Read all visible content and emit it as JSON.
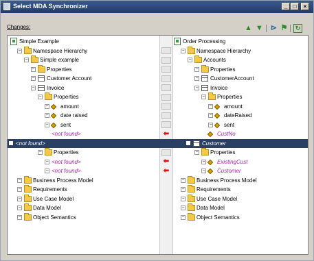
{
  "window": {
    "title": "Select MDA Synchronizer",
    "buttons": [
      "_",
      "□",
      "×"
    ]
  },
  "toolbar": {
    "changes_label": "Changes:",
    "icons": [
      "arrow-up-icon",
      "arrow-down-icon",
      "filter-icon",
      "flag-icon",
      "refresh-icon"
    ]
  },
  "colors": {
    "selected_row": "#2a3f64",
    "not_found_text": "#b020b0",
    "change_arrow": "#e01010"
  },
  "left_tree": [
    {
      "label": "Simple Example",
      "icon": "model-icon"
    },
    {
      "label": "Namespace Hierarchy",
      "icon": "folder-icon"
    },
    {
      "label": "Simple example",
      "icon": "folder-icon"
    },
    {
      "label": "Properties",
      "icon": "folder-icon"
    },
    {
      "label": "Customer Account",
      "icon": "class-icon"
    },
    {
      "label": "Invoice",
      "icon": "class-icon"
    },
    {
      "label": "Properties",
      "icon": "folder-icon"
    },
    {
      "label": "amount",
      "icon": "attribute-icon"
    },
    {
      "label": "date raised",
      "icon": "attribute-icon"
    },
    {
      "label": "sent",
      "icon": "attribute-icon"
    },
    {
      "label": "<not found>",
      "icon": "none"
    },
    {
      "label": "<not found>",
      "icon": "none"
    },
    {
      "label": "Properties",
      "icon": "folder-icon"
    },
    {
      "label": "<not found>",
      "icon": "none"
    },
    {
      "label": "<not found>",
      "icon": "none"
    },
    {
      "label": "Business Process Model",
      "icon": "folder-icon"
    },
    {
      "label": "Requirements",
      "icon": "folder-icon"
    },
    {
      "label": "Use Case Model",
      "icon": "folder-icon"
    },
    {
      "label": "Data Model",
      "icon": "folder-icon"
    },
    {
      "label": "Object Semantics",
      "icon": "folder-icon"
    }
  ],
  "right_tree": [
    {
      "label": "Order Processing",
      "icon": "model-icon"
    },
    {
      "label": "Namespace Hierarchy",
      "icon": "folder-icon"
    },
    {
      "label": "Accounts",
      "icon": "folder-icon"
    },
    {
      "label": "Properties",
      "icon": "folder-icon"
    },
    {
      "label": "CustomerAccount",
      "icon": "class-icon"
    },
    {
      "label": "Invoice",
      "icon": "class-icon"
    },
    {
      "label": "Properties",
      "icon": "folder-icon"
    },
    {
      "label": "amount",
      "icon": "attribute-icon"
    },
    {
      "label": "dateRaised",
      "icon": "attribute-icon"
    },
    {
      "label": "sent",
      "icon": "attribute-icon"
    },
    {
      "label": "CustNo",
      "icon": "attribute-icon"
    },
    {
      "label": "Customer",
      "icon": "class-icon"
    },
    {
      "label": "Properties",
      "icon": "folder-icon"
    },
    {
      "label": "ExistingCust",
      "icon": "attribute-icon"
    },
    {
      "label": "Customer",
      "icon": "attribute-icon"
    },
    {
      "label": "Business Process Model",
      "icon": "folder-icon"
    },
    {
      "label": "Requirements",
      "icon": "folder-icon"
    },
    {
      "label": "Use Case Model",
      "icon": "folder-icon"
    },
    {
      "label": "Data Model",
      "icon": "folder-icon"
    },
    {
      "label": "Object Semantics",
      "icon": "folder-icon"
    }
  ],
  "change_arrow_rows": [
    10,
    11,
    13,
    14
  ],
  "selected_row": 11
}
